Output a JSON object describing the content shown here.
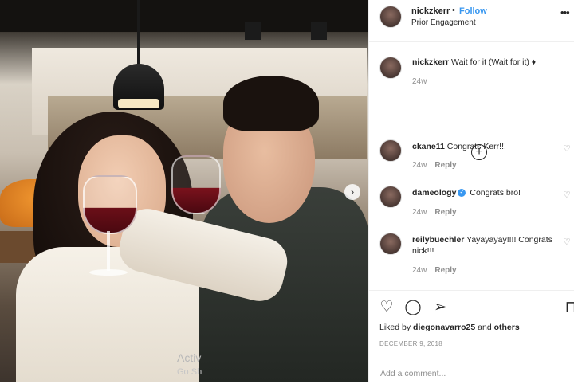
{
  "header": {
    "username": "nickzkerr",
    "separator": "•",
    "follow_label": "Follow",
    "location": "Prior Engagement",
    "more_icon": "ellipsis-icon"
  },
  "caption": {
    "username": "nickzkerr",
    "text": "Wait for it (Wait for it) ♦",
    "time": "24w"
  },
  "comments": [
    {
      "username": "ckane11",
      "text": "Congrats Kerr!!!",
      "time": "24w",
      "reply": "Reply",
      "verified": false
    },
    {
      "username": "dameology",
      "text": "Congrats bro!",
      "time": "24w",
      "reply": "Reply",
      "verified": true
    },
    {
      "username": "reilybuechler",
      "text": "Yayayayay!!!! Congrats nick!!!",
      "time": "24w",
      "reply": "Reply",
      "verified": false
    }
  ],
  "actions": {
    "like_icon": "heart-icon",
    "comment_icon": "comment-icon",
    "share_icon": "share-icon",
    "save_icon": "bookmark-icon"
  },
  "likes": {
    "prefix": "Liked by",
    "user": "diegonavarro25",
    "suffix": "and others"
  },
  "date": "DECEMBER 9, 2018",
  "add_comment": {
    "placeholder": "Add a comment..."
  },
  "watermark": {
    "line1": "Activ",
    "line2": "Go Sh"
  }
}
